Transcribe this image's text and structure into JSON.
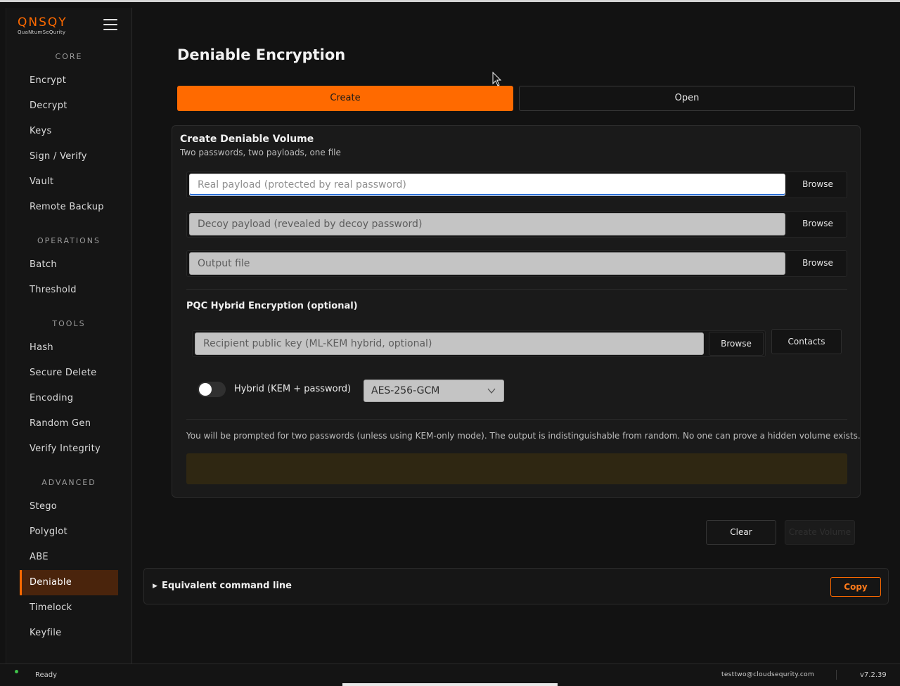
{
  "app": {
    "logo_text": "QNSQY",
    "logo_subtext": "QuaNtumSeQurity"
  },
  "sidebar": {
    "sections": [
      {
        "title": "CORE",
        "items": [
          "Encrypt",
          "Decrypt",
          "Keys",
          "Sign / Verify",
          "Vault",
          "Remote Backup"
        ]
      },
      {
        "title": "OPERATIONS",
        "items": [
          "Batch",
          "Threshold"
        ]
      },
      {
        "title": "TOOLS",
        "items": [
          "Hash",
          "Secure Delete",
          "Encoding",
          "Random Gen",
          "Verify Integrity"
        ]
      },
      {
        "title": "ADVANCED",
        "items": [
          "Stego",
          "Polyglot",
          "ABE",
          "Deniable",
          "Timelock",
          "Keyfile"
        ]
      }
    ],
    "active_item": "Deniable"
  },
  "page": {
    "title": "Deniable Encryption",
    "tabs": {
      "create": "Create",
      "open": "Open"
    }
  },
  "panel": {
    "title": "Create Deniable Volume",
    "subtitle": "Two passwords, two payloads, one file",
    "fields": [
      {
        "placeholder": "Real payload (protected by real password)",
        "value": "",
        "browse": "Browse"
      },
      {
        "placeholder": "Decoy payload (revealed by decoy password)",
        "value": "",
        "browse": "Browse"
      },
      {
        "placeholder": "Output file",
        "value": "",
        "browse": "Browse"
      }
    ],
    "pqc": {
      "title": "PQC Hybrid Encryption (optional)",
      "recipient_placeholder": "Recipient public key (ML-KEM hybrid, optional)",
      "browse": "Browse",
      "contacts": "Contacts",
      "hybrid_label": "Hybrid (KEM + password)",
      "hybrid_enabled": false,
      "cipher": "AES-256-GCM"
    },
    "note": "You will be prompted for two passwords (unless using KEM-only mode). The output is indistinguishable from random. No one can prove a hidden volume exists."
  },
  "actions": {
    "clear": "Clear",
    "create_volume": "Create Volume"
  },
  "command_line": {
    "label": "Equivalent command line",
    "copy": "Copy"
  },
  "statusbar": {
    "status": "Ready",
    "user": "testtwo@cloudsequrity.com",
    "version": "v7.2.39"
  },
  "colors": {
    "accent": "#ff6a00",
    "background": "#121212",
    "active_nav_bg": "#4a240c"
  }
}
